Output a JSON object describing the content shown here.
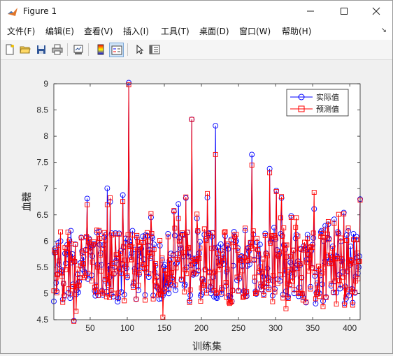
{
  "window": {
    "title": "Figure 1"
  },
  "menubar": {
    "items": [
      "文件(F)",
      "编辑(E)",
      "查看(V)",
      "插入(I)",
      "工具(T)",
      "桌面(D)",
      "窗口(W)",
      "帮助(H)"
    ],
    "more_arrow": "↘"
  },
  "toolbar": {
    "icons": [
      "new-figure-icon",
      "open-file-icon",
      "save-icon",
      "print-icon",
      "link-plot-icon",
      "insert-colorbar-icon",
      "insert-legend-icon",
      "edit-plot-arrow-icon",
      "property-editor-icon"
    ]
  },
  "chart_data": {
    "type": "line",
    "xlabel": "训练集",
    "ylabel": "血糖",
    "xlim": [
      1,
      414
    ],
    "ylim": [
      4.5,
      9
    ],
    "xticks": [
      50,
      100,
      150,
      200,
      250,
      300,
      350,
      400
    ],
    "yticks": [
      4.5,
      5,
      5.5,
      6,
      6.5,
      7,
      7.5,
      8,
      8.5,
      9
    ],
    "legend_placement": "top-right",
    "grid": false,
    "series": [
      {
        "name": "实际值",
        "color": "#0000ff",
        "marker": "circle"
      },
      {
        "name": "预测值",
        "color": "#ff0000",
        "marker": "square"
      }
    ],
    "notable_points": [
      {
        "x": 1,
        "actual": 4.85,
        "predicted": 5.05
      },
      {
        "x": 28,
        "actual": 4.48,
        "predicted": 4.47
      },
      {
        "x": 102,
        "actual": 9.02,
        "predicted": 8.98
      },
      {
        "x": 187,
        "actual": 8.32,
        "predicted": 8.32
      },
      {
        "x": 219,
        "actual": 8.2,
        "predicted": 7.65
      },
      {
        "x": 268,
        "actual": 7.65,
        "predicted": 7.45
      },
      {
        "x": 292,
        "actual": 7.38,
        "predicted": 7.3
      },
      {
        "x": 414,
        "actual": 6.8,
        "predicted": 6.78
      }
    ]
  }
}
